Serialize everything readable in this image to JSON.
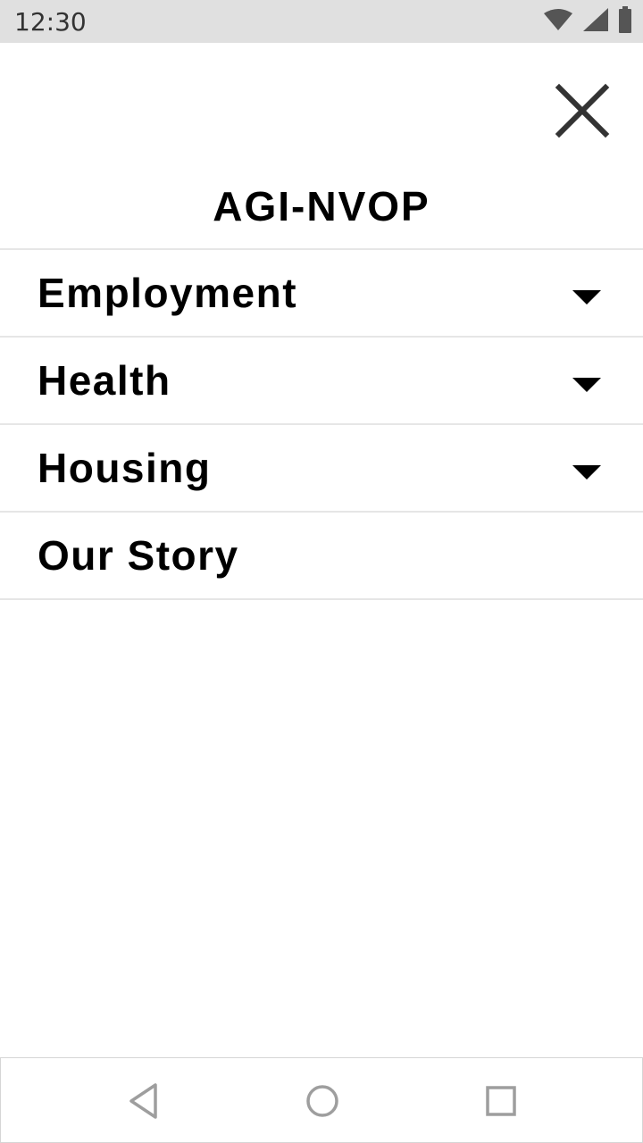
{
  "status_bar": {
    "time": "12:30",
    "icons": [
      "wifi-icon",
      "signal-icon",
      "battery-icon"
    ]
  },
  "menu": {
    "title": "AGI-NVOP",
    "close_icon": "close-icon",
    "items": [
      {
        "label": "Employment",
        "has_dropdown": true
      },
      {
        "label": "Health",
        "has_dropdown": true
      },
      {
        "label": "Housing",
        "has_dropdown": true
      },
      {
        "label": "Our Story",
        "has_dropdown": false
      }
    ]
  },
  "nav_bar": {
    "buttons": [
      "back-icon",
      "home-icon",
      "recents-icon"
    ]
  },
  "colors": {
    "status_bar_bg": "#e0e0e0",
    "divider": "#e6e6e6",
    "text": "#000000",
    "nav_icon": "#9e9e9e"
  }
}
